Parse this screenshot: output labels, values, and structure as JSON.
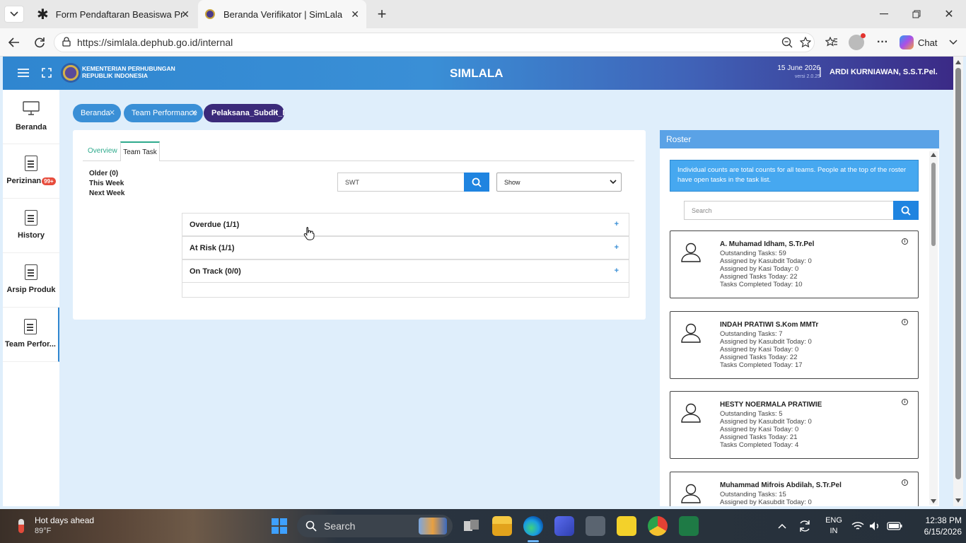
{
  "browser": {
    "tabs": [
      {
        "title": "Form Pendaftaran Beasiswa Progra",
        "icon": "asterisk-icon",
        "active": false
      },
      {
        "title": "Beranda Verifikator | SimLala",
        "icon": "emblem-icon",
        "active": true
      }
    ],
    "new_tab": "+",
    "url": "https://simlala.dephub.go.id/internal",
    "chat_label": "Chat"
  },
  "header": {
    "org_line1": "KEMENTERIAN PERHUBUNGAN",
    "org_line2": "REPUBLIK INDONESIA",
    "app_title": "SIMLALA",
    "date": "15 June 2026",
    "version": "versi 2.0.25",
    "separator": "|",
    "user": "ARDI KURNIAWAN, S.S.T.Pel."
  },
  "sidebar": {
    "items": [
      {
        "label": "Beranda",
        "icon": "monitor-icon"
      },
      {
        "label": "Perizinan",
        "icon": "document-icon",
        "badge": "99+"
      },
      {
        "label": "History",
        "icon": "document-icon"
      },
      {
        "label": "Arsip Produk",
        "icon": "document-icon"
      },
      {
        "label": "Team Perfor...",
        "icon": "document-icon"
      }
    ]
  },
  "breadcrumbs": [
    {
      "label": "Beranda",
      "color": "#3a8fd6"
    },
    {
      "label": "Team Performance",
      "color": "#3a8fd6"
    },
    {
      "label": "Pelaksana_Subdit_I",
      "color": "#3b2a7a"
    }
  ],
  "main": {
    "tabs": [
      "Overview",
      "Team Task"
    ],
    "periods": [
      "Older (0)",
      "This Week",
      "Next Week"
    ],
    "search_value": "SWT",
    "show_select": "Show",
    "accordions": [
      {
        "label": "Overdue (1/1)",
        "toggle": "+"
      },
      {
        "label": "At Risk (1/1)",
        "toggle": "+"
      },
      {
        "label": "On Track (0/0)",
        "toggle": "+"
      }
    ]
  },
  "roster": {
    "title": "Roster",
    "notice": "Individual counts are total counts for all teams. People at the top of the roster have open tasks in the task list.",
    "search_placeholder": "Search",
    "people": [
      {
        "name": "A. Muhamad Idham, S.Tr.Pel",
        "lines": [
          "Outstanding Tasks: 59",
          "Assigned by Kasubdit Today: 0",
          "Assigned by Kasi Today: 0",
          "Assigned Tasks Today: 22",
          "Tasks Completed Today: 10"
        ]
      },
      {
        "name": "INDAH PRATIWI S.Kom MMTr",
        "lines": [
          "Outstanding Tasks: 7",
          "Assigned by Kasubdit Today: 0",
          "Assigned by Kasi Today: 0",
          "Assigned Tasks Today: 22",
          "Tasks Completed Today: 17"
        ]
      },
      {
        "name": "HESTY NOERMALA PRATIWIE",
        "lines": [
          "Outstanding Tasks: 5",
          "Assigned by Kasubdit Today: 0",
          "Assigned by Kasi Today: 0",
          "Assigned Tasks Today: 21",
          "Tasks Completed Today: 4"
        ]
      },
      {
        "name": "Muhammad Mifrois Abdilah, S.Tr.Pel",
        "lines": [
          "Outstanding Tasks: 15",
          "Assigned by Kasubdit Today: 0"
        ]
      }
    ]
  },
  "taskbar": {
    "weather_title": "Hot days ahead",
    "weather_temp": "89°F",
    "search_placeholder": "Search",
    "lang1": "ENG",
    "lang2": "IN",
    "time": "12:38 PM",
    "date": "6/15/2026"
  },
  "colors": {
    "accent": "#3a8fd6",
    "header_dark": "#3b2a86",
    "notice_bg": "#46a8f0",
    "tab_green": "#2eaa8c"
  }
}
